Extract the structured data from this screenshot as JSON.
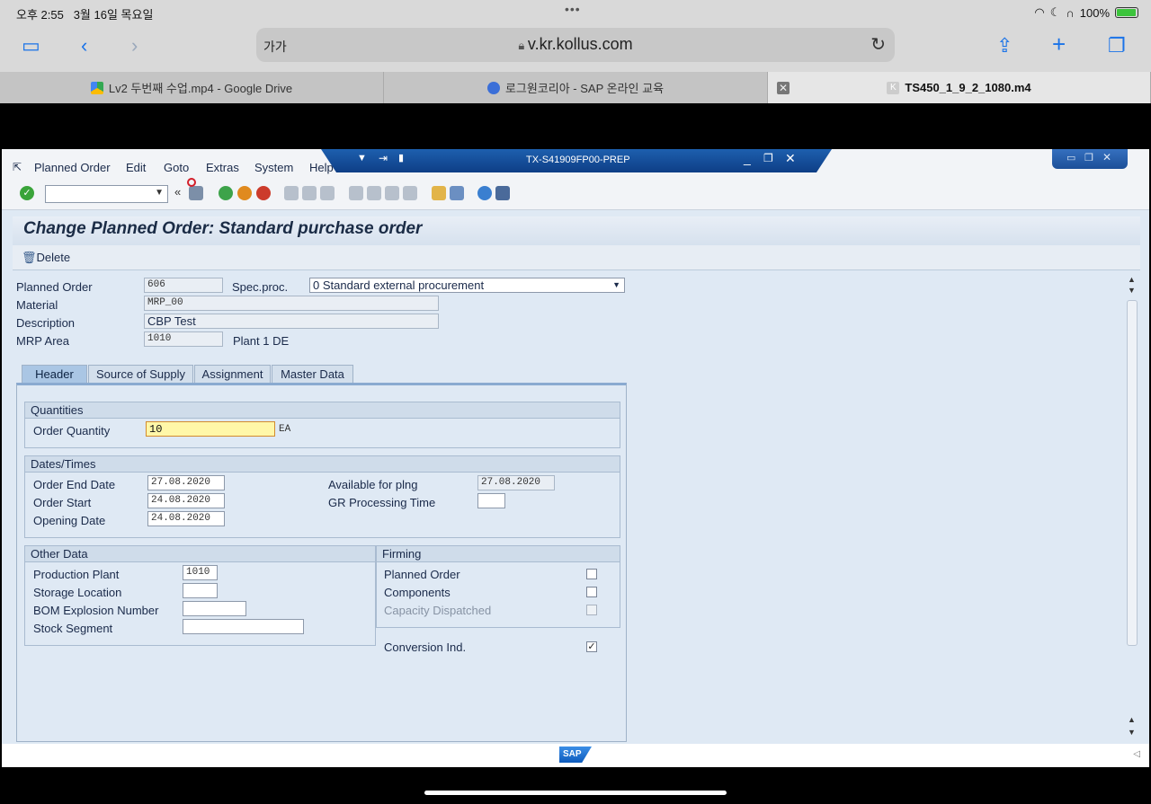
{
  "status_bar": {
    "time": "오후 2:55",
    "date": "3월 16일 목요일",
    "battery": "100%"
  },
  "browser": {
    "text_size_button": "가가",
    "url": "v.kr.kollus.com",
    "tabs": [
      {
        "label": "Lv2 두번째 수업.mp4 - Google Drive",
        "active": false
      },
      {
        "label": "로그원코리아 - SAP 온라인 교육",
        "active": false
      },
      {
        "label": "TS450_1_9_2_1080.m4",
        "active": true
      }
    ]
  },
  "sap": {
    "menu": [
      "Planned Order",
      "Edit",
      "Goto",
      "Extras",
      "System",
      "Help"
    ],
    "system_title": "TX-S41909FP00-PREP",
    "screen_title": "Change Planned Order: Standard purchase order",
    "app_toolbar": {
      "delete_label": "Delete"
    },
    "header_fields": {
      "planned_order_label": "Planned Order",
      "planned_order_value": "606",
      "spec_proc_label": "Spec.proc.",
      "spec_proc_value": "0 Standard external procurement",
      "material_label": "Material",
      "material_value": "MRP_00",
      "description_label": "Description",
      "description_value": "CBP Test",
      "mrp_area_label": "MRP Area",
      "mrp_area_value": "1010",
      "mrp_area_text": "Plant 1 DE"
    },
    "tabs": [
      "Header",
      "Source of Supply",
      "Assignment",
      "Master Data"
    ],
    "quantities": {
      "title": "Quantities",
      "order_qty_label": "Order Quantity",
      "order_qty_value": "10",
      "unit": "EA"
    },
    "dates": {
      "title": "Dates/Times",
      "order_end_label": "Order End Date",
      "order_end_value": "27.08.2020",
      "order_start_label": "Order Start",
      "order_start_value": "24.08.2020",
      "opening_label": "Opening Date",
      "opening_value": "24.08.2020",
      "available_label": "Available for plng",
      "available_value": "27.08.2020",
      "gr_label": "GR Processing Time",
      "gr_value": ""
    },
    "other_data": {
      "title": "Other Data",
      "production_plant_label": "Production Plant",
      "production_plant_value": "1010",
      "storage_location_label": "Storage Location",
      "storage_location_value": "",
      "bom_label": "BOM Explosion Number",
      "bom_value": "",
      "stock_segment_label": "Stock Segment",
      "stock_segment_value": ""
    },
    "firming": {
      "title": "Firming",
      "planned_order_label": "Planned Order",
      "components_label": "Components",
      "capacity_label": "Capacity Dispatched",
      "conversion_label": "Conversion Ind.",
      "conversion_checked": "✓"
    }
  }
}
